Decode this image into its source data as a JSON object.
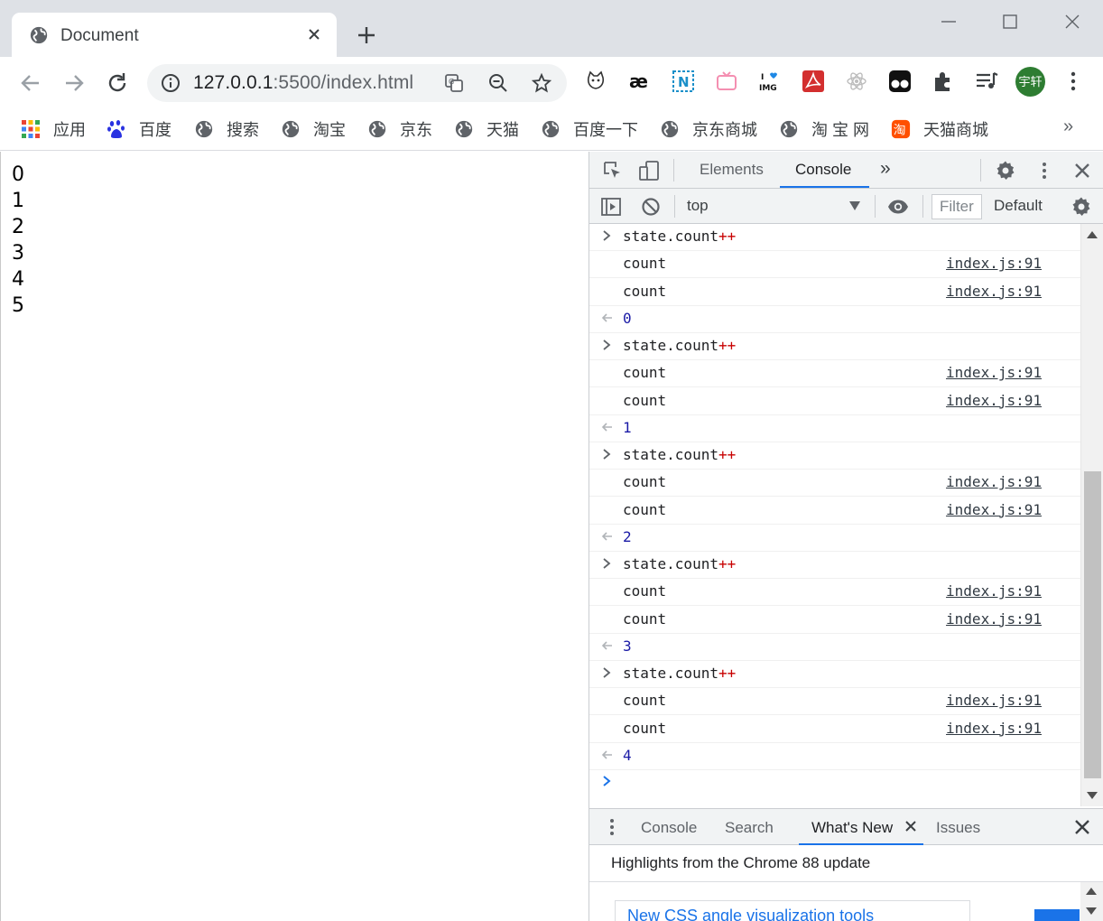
{
  "browser": {
    "tab_title": "Document",
    "url_host": "127.0.0.1",
    "url_path": ":5500/index.html",
    "avatar_label": "宇轩",
    "icons": [
      "globe-icon",
      "close-icon",
      "plus-icon",
      "minimize-icon",
      "maximize-icon",
      "window-close-icon",
      "back-icon",
      "forward-icon",
      "reload-icon",
      "info-icon",
      "translate-icon",
      "zoom-icon",
      "star-icon",
      "extensions-icon",
      "menu-icon"
    ]
  },
  "bookmarks": [
    {
      "label": "应用"
    },
    {
      "label": "百度"
    },
    {
      "label": "搜索"
    },
    {
      "label": "淘宝"
    },
    {
      "label": "京东"
    },
    {
      "label": "天猫"
    },
    {
      "label": "百度一下"
    },
    {
      "label": "京东商城"
    },
    {
      "label": "淘 宝 网"
    },
    {
      "label": "天猫商城"
    }
  ],
  "bookmarks_more": "»",
  "page": {
    "lines": [
      "0",
      "1",
      "2",
      "3",
      "4",
      "5"
    ]
  },
  "devtools": {
    "tabs": [
      "Elements",
      "Console"
    ],
    "more_tabs": "»",
    "context": "top",
    "filter_placeholder": "Filter",
    "levels": "Default",
    "console": {
      "input_text": "state.count",
      "input_op": "++",
      "log_text": "count",
      "log_source": "index.js:91",
      "results": [
        "0",
        "1",
        "2",
        "3",
        "4"
      ]
    },
    "drawer": {
      "tabs": [
        "Console",
        "Search",
        "What's New",
        "Issues"
      ],
      "active": "What's New",
      "highlights": "Highlights from the Chrome 88 update",
      "card_title": "New CSS angle visualization tools"
    }
  },
  "colors": {
    "tabstrip": "#dee1e6",
    "accent": "#1a73e8",
    "avatar": "#2e7d32",
    "console_result": "#1a1aa6"
  }
}
